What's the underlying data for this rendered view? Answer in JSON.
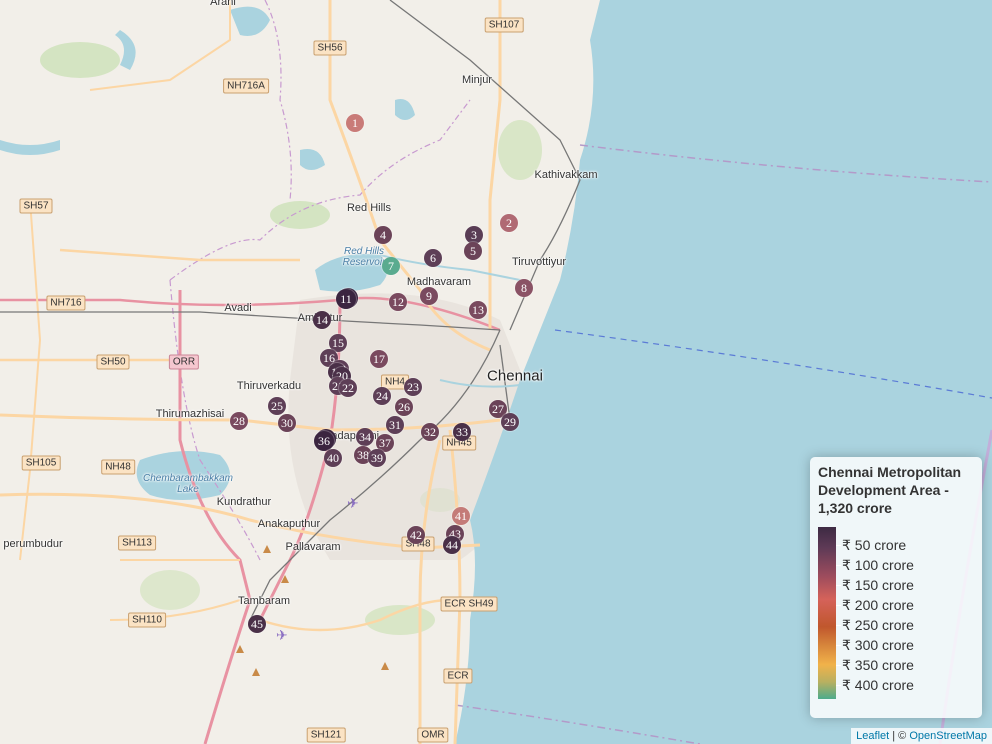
{
  "legend": {
    "title": "Chennai Metropolitan Development Area - 1,320 crore",
    "labels": [
      "₹ 50 crore",
      "₹ 100 crore",
      "₹ 150 crore",
      "₹ 200 crore",
      "₹ 250 crore",
      "₹ 300 crore",
      "₹ 350 crore",
      "₹ 400 crore"
    ]
  },
  "attribution": {
    "leaflet": "Leaflet",
    "separator": " | © ",
    "osm": "OpenStreetMap"
  },
  "places": [
    {
      "id": "arani",
      "label": "Arani"
    },
    {
      "id": "minjur",
      "label": "Minjur"
    },
    {
      "id": "kathivakkam",
      "label": "Kathivakkam"
    },
    {
      "id": "red-hills",
      "label": "Red Hills"
    },
    {
      "id": "red-hills-reservoir",
      "label": "Red Hills Reservoir"
    },
    {
      "id": "tiruvottiyur",
      "label": "Tiruvottiyur"
    },
    {
      "id": "madhavaram",
      "label": "Madhavaram"
    },
    {
      "id": "avadi",
      "label": "Avadi"
    },
    {
      "id": "ambattur",
      "label": "Ambattur"
    },
    {
      "id": "chennai",
      "label": "Chennai"
    },
    {
      "id": "thiruverkadu",
      "label": "Thiruverkadu"
    },
    {
      "id": "thirumazhisai",
      "label": "Thirumazhisai"
    },
    {
      "id": "chembarambakkam-lake",
      "label": "Chembarambakkam Lake"
    },
    {
      "id": "kundrathur",
      "label": "Kundrathur"
    },
    {
      "id": "anakaputhur",
      "label": "Anakaputhur"
    },
    {
      "id": "pallavaram",
      "label": "Pallavaram"
    },
    {
      "id": "tambaram",
      "label": "Tambaram"
    },
    {
      "id": "sriperumbudur",
      "label": "perumbudur"
    },
    {
      "id": "vadapalani",
      "label": "Vadapalani"
    }
  ],
  "road_shields": [
    "SH107",
    "SH56",
    "NH716A",
    "SH57",
    "NH716",
    "SH50",
    "ORR",
    "NH4",
    "NH45",
    "SH105",
    "NH48",
    "SH113",
    "SH48",
    "SH110",
    "ECR SH49",
    "ECR",
    "SH121",
    "OMR"
  ],
  "markers": [
    {
      "n": "1",
      "color": "#c97b78"
    },
    {
      "n": "2",
      "color": "#b06a73"
    },
    {
      "n": "3",
      "color": "#5a3d55"
    },
    {
      "n": "4",
      "color": "#6b4358"
    },
    {
      "n": "5",
      "color": "#6b4358"
    },
    {
      "n": "6",
      "color": "#5e3f57"
    },
    {
      "n": "7",
      "color": "#5aab8f"
    },
    {
      "n": "8",
      "color": "#8a5265"
    },
    {
      "n": "9",
      "color": "#7a4a5f"
    },
    {
      "n": "10",
      "color": "#3b2540"
    },
    {
      "n": "11",
      "color": "#3b2540"
    },
    {
      "n": "12",
      "color": "#7a4a5f"
    },
    {
      "n": "13",
      "color": "#7a4a5f"
    },
    {
      "n": "14",
      "color": "#4a3048"
    },
    {
      "n": "15",
      "color": "#5e3f57"
    },
    {
      "n": "16",
      "color": "#5e3f57"
    },
    {
      "n": "17",
      "color": "#7a4a5f"
    },
    {
      "n": "18",
      "color": "#5e3f57"
    },
    {
      "n": "19",
      "color": "#4a3048"
    },
    {
      "n": "20",
      "color": "#4a3048"
    },
    {
      "n": "21",
      "color": "#5e3f57"
    },
    {
      "n": "22",
      "color": "#5e3f57"
    },
    {
      "n": "23",
      "color": "#5e3f57"
    },
    {
      "n": "24",
      "color": "#5e3f57"
    },
    {
      "n": "25",
      "color": "#5e3f57"
    },
    {
      "n": "26",
      "color": "#6b4358"
    },
    {
      "n": "27",
      "color": "#6b4358"
    },
    {
      "n": "28",
      "color": "#7a4a5f"
    },
    {
      "n": "29",
      "color": "#5e3f57"
    },
    {
      "n": "30",
      "color": "#6b4358"
    },
    {
      "n": "31",
      "color": "#5e3f57"
    },
    {
      "n": "32",
      "color": "#6b4358"
    },
    {
      "n": "33",
      "color": "#4a3048"
    },
    {
      "n": "34",
      "color": "#5e3f57"
    },
    {
      "n": "35",
      "color": "#3b2540"
    },
    {
      "n": "36",
      "color": "#3b2540"
    },
    {
      "n": "37",
      "color": "#6b4358"
    },
    {
      "n": "38",
      "color": "#6b4358"
    },
    {
      "n": "39",
      "color": "#5e3f57"
    },
    {
      "n": "40",
      "color": "#5e3f57"
    },
    {
      "n": "41",
      "color": "#c47b78"
    },
    {
      "n": "42",
      "color": "#6b4358"
    },
    {
      "n": "43",
      "color": "#6b4358"
    },
    {
      "n": "44",
      "color": "#4a3048"
    },
    {
      "n": "45",
      "color": "#4a3048"
    }
  ]
}
